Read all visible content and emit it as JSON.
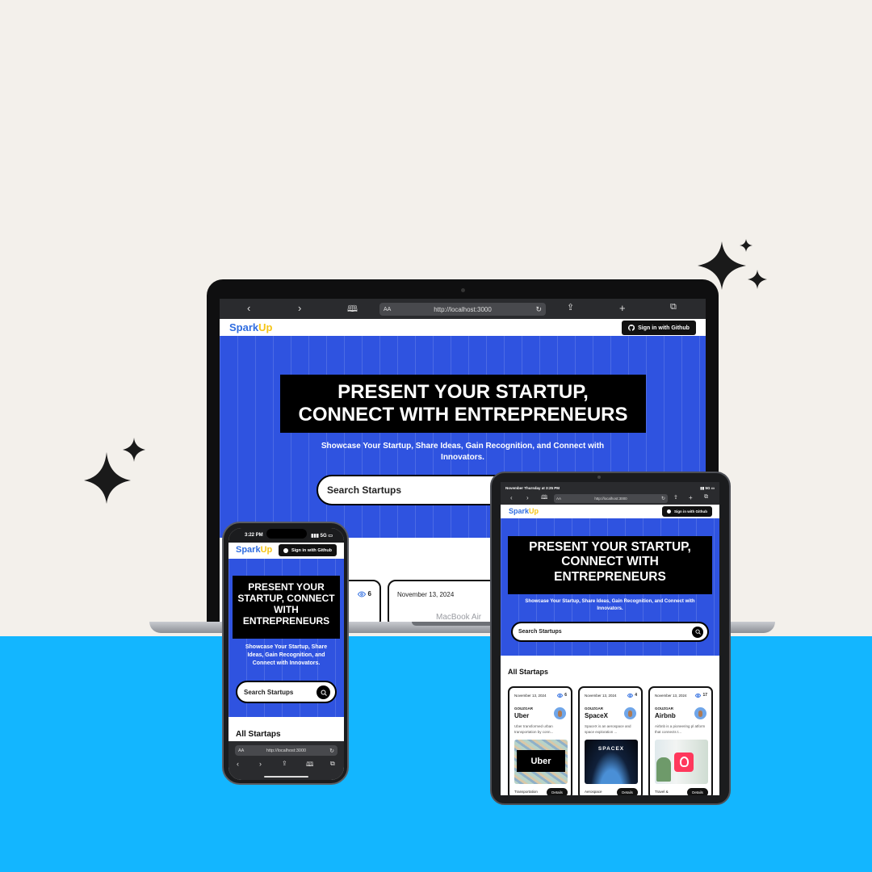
{
  "colors": {
    "background_top": "#f3f0eb",
    "background_bottom": "#13b6ff",
    "hero_blue": "#2f53e0",
    "brand_blue": "#2f6de0",
    "brand_yellow": "#f5c518"
  },
  "brand": {
    "spark": "Spark",
    "up": "Up"
  },
  "github_button": "Sign in with Github",
  "hero": {
    "title_line1": "PRESENT YOUR STARTUP,",
    "title_line2": "CONNECT WITH ENTREPRENEURS",
    "subtitle": "Showcase Your Startup, Share Ideas, Gain Recognition, and Connect with Innovators.",
    "search_placeholder": "Search Startups"
  },
  "section_title": "All Startaps",
  "laptop": {
    "label": "MacBook Air",
    "url": "http://localhost:3000",
    "aa": "AA",
    "visible_cards": [
      {
        "views": "6"
      },
      {
        "date": "November 13, 2024"
      }
    ]
  },
  "phone": {
    "time": "3:22 PM",
    "signal": "5G",
    "url": "http://localhost:3000",
    "aa": "AA",
    "hero_title": "PRESENT YOUR STARTUP, CONNECT WITH ENTREPRENEURS"
  },
  "tablet": {
    "status_time": "November Thursday at 3:25 PM",
    "signal": "5G",
    "url": "http://localhost:3000",
    "aa": "AA",
    "hero_title": "PRESENT YOUR STARTUP, CONNECT WITH ENTREPRENEURS",
    "cards": [
      {
        "date": "November 13, 2024",
        "views": "6",
        "author": "GOUZGAR",
        "name": "Uber",
        "desc": "Uber transformed urban transportation by conn...",
        "image_text": "Uber",
        "category": "Transportation",
        "details": "Details"
      },
      {
        "date": "November 13, 2024",
        "views": "4",
        "author": "GOUZGAR",
        "name": "SpaceX",
        "desc": "SpaceX is an aerospace and space exploration ...",
        "image_text": "SPACEX",
        "category": "Aerospace",
        "details": "Details"
      },
      {
        "date": "November 13, 2024",
        "views": "17",
        "author": "GOUZGAR",
        "name": "Airbnb",
        "desc": "Airbnb is a pioneering pl atform that connects t...",
        "image_text": "",
        "category": "Travel &",
        "details": "Details"
      }
    ]
  },
  "icons": {
    "back": "chevron-left-icon",
    "forward": "chevron-right-icon",
    "bookmarks": "book-icon",
    "share": "share-icon",
    "new_tab": "plus-icon",
    "tabs": "tabs-icon",
    "reload": "reload-icon",
    "search": "search-icon",
    "github": "github-icon",
    "views": "eye-icon",
    "sparkle": "sparkle-icon"
  }
}
